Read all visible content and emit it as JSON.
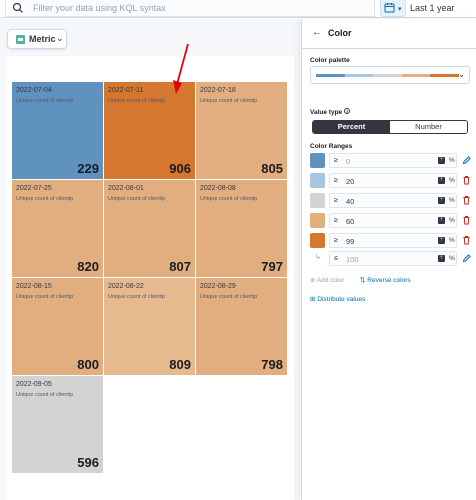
{
  "query_bar": {
    "placeholder": "Filter your data using KQL syntax",
    "date_range": "Last 1 year",
    "search_icon": "search-icon",
    "calendar_icon": "calendar-icon"
  },
  "toolbar": {
    "visualization_type": "Metric"
  },
  "tiles": [
    {
      "date": "2022-07-04",
      "label": "Unique count of clientip",
      "value": "229",
      "color": "#6092c0"
    },
    {
      "date": "2022-07-11",
      "label": "Unique count of clientip",
      "value": "906",
      "color": "#d6772f"
    },
    {
      "date": "2022-07-18",
      "label": "Unique count of clientip",
      "value": "805",
      "color": "#e2ae7f"
    },
    {
      "date": "2022-07-25",
      "label": "Unique count of clientip",
      "value": "820",
      "color": "#e2ae7f"
    },
    {
      "date": "2022-08-01",
      "label": "Unique count of clientip",
      "value": "807",
      "color": "#e2ae7f"
    },
    {
      "date": "2022-08-08",
      "label": "Unique count of clientip",
      "value": "797",
      "color": "#e2ae7f"
    },
    {
      "date": "2022-08-15",
      "label": "Unique count of clientip",
      "value": "800",
      "color": "#e2ae7f"
    },
    {
      "date": "2022-08-22",
      "label": "Unique count of clientip",
      "value": "809",
      "color": "#e7b98f"
    },
    {
      "date": "2022-08-29",
      "label": "Unique count of clientip",
      "value": "798",
      "color": "#e2ae7f"
    },
    {
      "date": "2022-09-05",
      "label": "Unique count of clientip",
      "value": "596",
      "color": "#d3d3d3"
    }
  ],
  "flyout": {
    "back_icon": "arrow-left-icon",
    "title": "Color",
    "palette_label": "Color palette",
    "palette_colors": [
      "#6092c0",
      "#a8c5e2",
      "#d3d3d3",
      "#e2b07f",
      "#d6772f"
    ],
    "value_type_label": "Value type",
    "value_type_options": [
      "Percent",
      "Number"
    ],
    "value_type_selected": "Percent",
    "color_ranges_label": "Color Ranges",
    "ranges": [
      {
        "color": "#6092c0",
        "value": "0",
        "placeholder": true,
        "action_icon": "pencil-icon"
      },
      {
        "color": "#a8c5e2",
        "value": "20",
        "placeholder": false,
        "action_icon": "trash-icon"
      },
      {
        "color": "#d3d3d3",
        "value": "40",
        "placeholder": false,
        "action_icon": "trash-icon"
      },
      {
        "color": "#e2b07f",
        "value": "60",
        "placeholder": false,
        "action_icon": "trash-icon"
      },
      {
        "color": "#d6772f",
        "value": "99",
        "placeholder": false,
        "action_icon": "trash-icon"
      }
    ],
    "end_value": "100",
    "ge_symbol": "≥",
    "less_symbol": "≤",
    "percent_symbol": "%",
    "add_color": "Add color",
    "reverse_colors": "Reverse colors",
    "distribute_values": "Distribute values"
  },
  "colors": {
    "accent": "#006bb8",
    "danger": "#bd271e",
    "annotation": "#e7000b"
  }
}
